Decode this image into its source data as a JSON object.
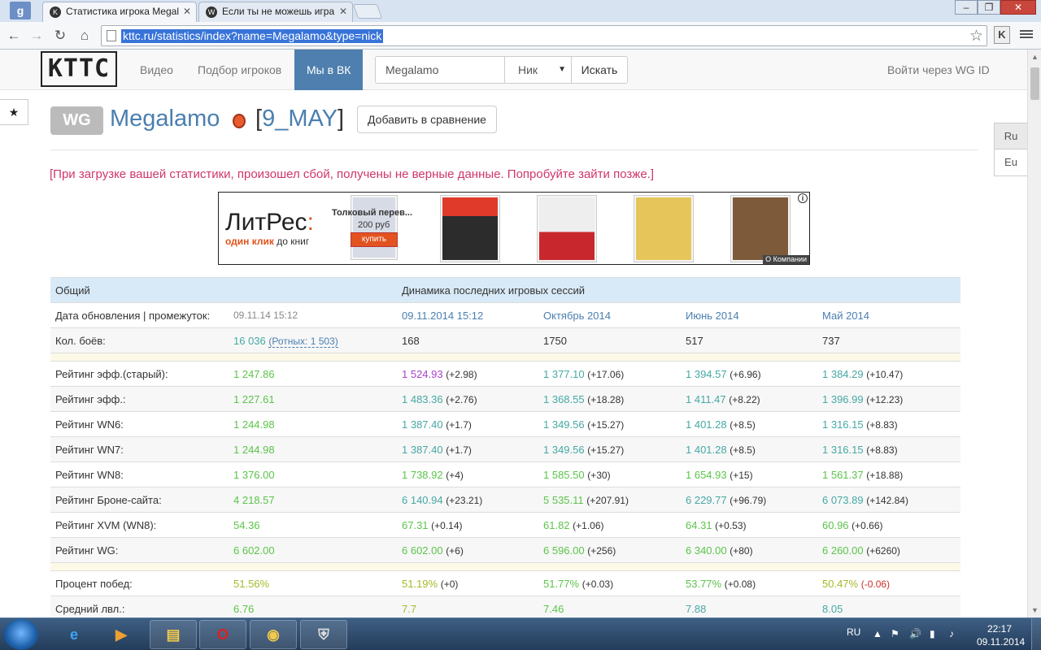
{
  "browser": {
    "tabs": [
      {
        "title": "Статистика игрока Megal",
        "favicon": "K"
      },
      {
        "title": "Если ты не можешь игра",
        "favicon": "W"
      }
    ],
    "url": "kttc.ru/statistics/index?name=Megalamo&type=nick",
    "ext_label": "K"
  },
  "site": {
    "logo": "KTTC",
    "nav": {
      "video": "Видео",
      "players": "Подбор игроков",
      "vk": "Мы в ВК",
      "login": "Войти через WG ID"
    },
    "search": {
      "value": "Megalamo",
      "type": "Ник",
      "button": "Искать"
    },
    "lang": {
      "ru": "Ru",
      "eu": "Eu"
    }
  },
  "player": {
    "badge": "WG",
    "name": "Megalamo",
    "clan_open": "[",
    "clan": "9_MAY",
    "clan_close": "]",
    "compare_button": "Добавить в сравнение"
  },
  "error_message": "[При загрузке вашей статистики, произошел сбой, получены не верные данные. Попробуйте зайти позже.]",
  "ad": {
    "logo_main": "ЛитРес",
    "logo_colon": ":",
    "slogan_hl": "один клик",
    "slogan_rest": " до книг",
    "book_title": "Толковый перев...",
    "book_price": "200 руб",
    "buy": "купить",
    "company": "О Компании"
  },
  "table": {
    "header": {
      "general": "Общий",
      "dynamics": "Динамика последних игровых сессий"
    },
    "update_row": {
      "label": "Дата обновления | промежуток:",
      "value": "09.11.14 15:12",
      "periods": [
        "09.11.2014 15:12",
        "Октябрь 2014",
        "Июнь 2014",
        "Май 2014"
      ]
    },
    "battles_row": {
      "label": "Кол. боёв:",
      "value": "16 036",
      "extra": "(Ротных: 1 503)",
      "periods": [
        "168",
        "1750",
        "517",
        "737"
      ]
    },
    "ratings": [
      {
        "label": "Рейтинг эфф.(старый):",
        "value": "1 247.86",
        "cells": [
          [
            "1 524.93",
            "(+2.98)"
          ],
          [
            "1 377.10",
            "(+17.06)"
          ],
          [
            "1 394.57",
            "(+6.96)"
          ],
          [
            "1 384.29",
            "(+10.47)"
          ]
        ]
      },
      {
        "label": "Рейтинг эфф.:",
        "value": "1 227.61",
        "cells": [
          [
            "1 483.36",
            "(+2.76)"
          ],
          [
            "1 368.55",
            "(+18.28)"
          ],
          [
            "1 411.47",
            "(+8.22)"
          ],
          [
            "1 396.99",
            "(+12.23)"
          ]
        ]
      },
      {
        "label": "Рейтинг WN6:",
        "value": "1 244.98",
        "cells": [
          [
            "1 387.40",
            "(+1.7)"
          ],
          [
            "1 349.56",
            "(+15.27)"
          ],
          [
            "1 401.28",
            "(+8.5)"
          ],
          [
            "1 316.15",
            "(+8.83)"
          ]
        ]
      },
      {
        "label": "Рейтинг WN7:",
        "value": "1 244.98",
        "cells": [
          [
            "1 387.40",
            "(+1.7)"
          ],
          [
            "1 349.56",
            "(+15.27)"
          ],
          [
            "1 401.28",
            "(+8.5)"
          ],
          [
            "1 316.15",
            "(+8.83)"
          ]
        ]
      },
      {
        "label": "Рейтинг WN8:",
        "value": "1 376.00",
        "cells": [
          [
            "1 738.92",
            "(+4)"
          ],
          [
            "1 585.50",
            "(+30)"
          ],
          [
            "1 654.93",
            "(+15)"
          ],
          [
            "1 561.37",
            "(+18.88)"
          ]
        ]
      },
      {
        "label": "Рейтинг Броне-сайта:",
        "value": "4 218.57",
        "cells": [
          [
            "6 140.94",
            "(+23.21)"
          ],
          [
            "5 535.11",
            "(+207.91)"
          ],
          [
            "6 229.77",
            "(+96.79)"
          ],
          [
            "6 073.89",
            "(+142.84)"
          ]
        ]
      },
      {
        "label": "Рейтинг XVM (WN8):",
        "value": "54.36",
        "cells": [
          [
            "67.31",
            "(+0.14)"
          ],
          [
            "61.82",
            "(+1.06)"
          ],
          [
            "64.31",
            "(+0.53)"
          ],
          [
            "60.96",
            "(+0.66)"
          ]
        ]
      },
      {
        "label": "Рейтинг WG:",
        "value": "6 602.00",
        "cells": [
          [
            "6 602.00",
            "(+6)"
          ],
          [
            "6 596.00",
            "(+256)"
          ],
          [
            "6 340.00",
            "(+80)"
          ],
          [
            "6 260.00",
            "(+6260)"
          ]
        ]
      }
    ],
    "winrate": {
      "label": "Процент побед:",
      "value": "51.56%",
      "cells": [
        [
          "51.19%",
          "(+0)"
        ],
        [
          "51.77%",
          "(+0.03)"
        ],
        [
          "53.77%",
          "(+0.08)"
        ],
        [
          "50.47%",
          "(-0.06)"
        ]
      ]
    },
    "avg_level": {
      "label": "Средний лвл.:",
      "value": "6.76",
      "cells": [
        "7.7",
        "7.46",
        "7.88",
        "8.05"
      ]
    }
  },
  "taskbar": {
    "lang": "RU",
    "time": "22:17",
    "date": "09.11.2014"
  },
  "colors": {
    "accent_blue": "#4a7fb0",
    "value_green": "#5bc44a",
    "error_pink": "#d1356d",
    "header_bg": "#d8eaf7"
  }
}
